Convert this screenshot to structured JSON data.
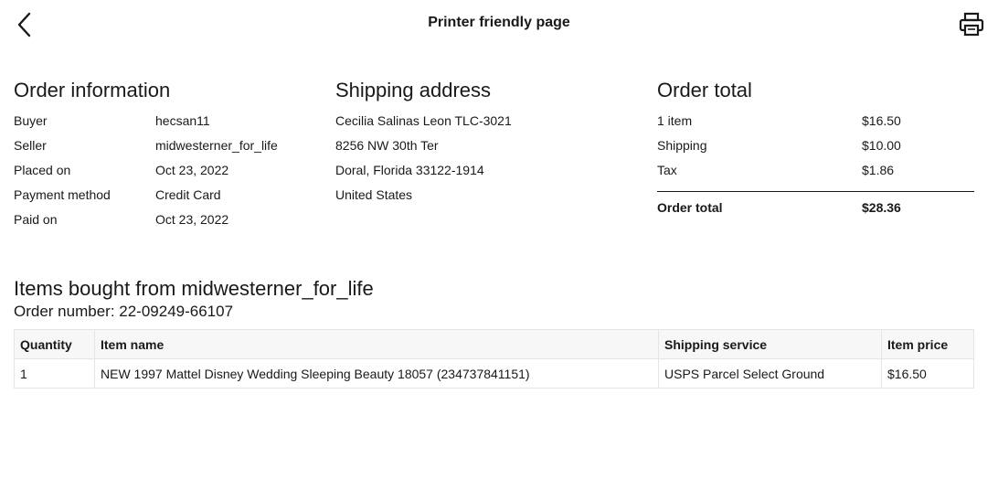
{
  "header": {
    "title": "Printer friendly page",
    "back_icon": "chevron-left-icon",
    "print_icon": "printer-icon"
  },
  "order_info": {
    "heading": "Order information",
    "rows": [
      {
        "label": "Buyer",
        "value": "hecsan11"
      },
      {
        "label": "Seller",
        "value": "midwesterner_for_life"
      },
      {
        "label": "Placed on",
        "value": "Oct 23, 2022"
      },
      {
        "label": "Payment method",
        "value": "Credit Card"
      },
      {
        "label": "Paid on",
        "value": "Oct 23, 2022"
      }
    ]
  },
  "shipping_address": {
    "heading": "Shipping address",
    "lines": [
      "Cecilia Salinas Leon TLC-3021",
      "8256 NW 30th Ter",
      "Doral, Florida 33122-1914",
      "United States"
    ]
  },
  "order_total": {
    "heading": "Order total",
    "rows": [
      {
        "label": "1 item",
        "value": "$16.50"
      },
      {
        "label": "Shipping",
        "value": "$10.00"
      },
      {
        "label": "Tax",
        "value": "$1.86"
      }
    ],
    "total_label": "Order total",
    "total_value": "$28.36"
  },
  "items": {
    "heading": "Items bought from midwesterner_for_life",
    "order_number": "Order number: 22-09249-66107",
    "columns": [
      "Quantity",
      "Item name",
      "Shipping service",
      "Item price"
    ],
    "rows": [
      {
        "quantity": "1",
        "name": "NEW 1997 Mattel Disney Wedding Sleeping Beauty 18057 (234737841151)",
        "shipping": "USPS Parcel Select Ground",
        "price": "$16.50"
      }
    ]
  }
}
